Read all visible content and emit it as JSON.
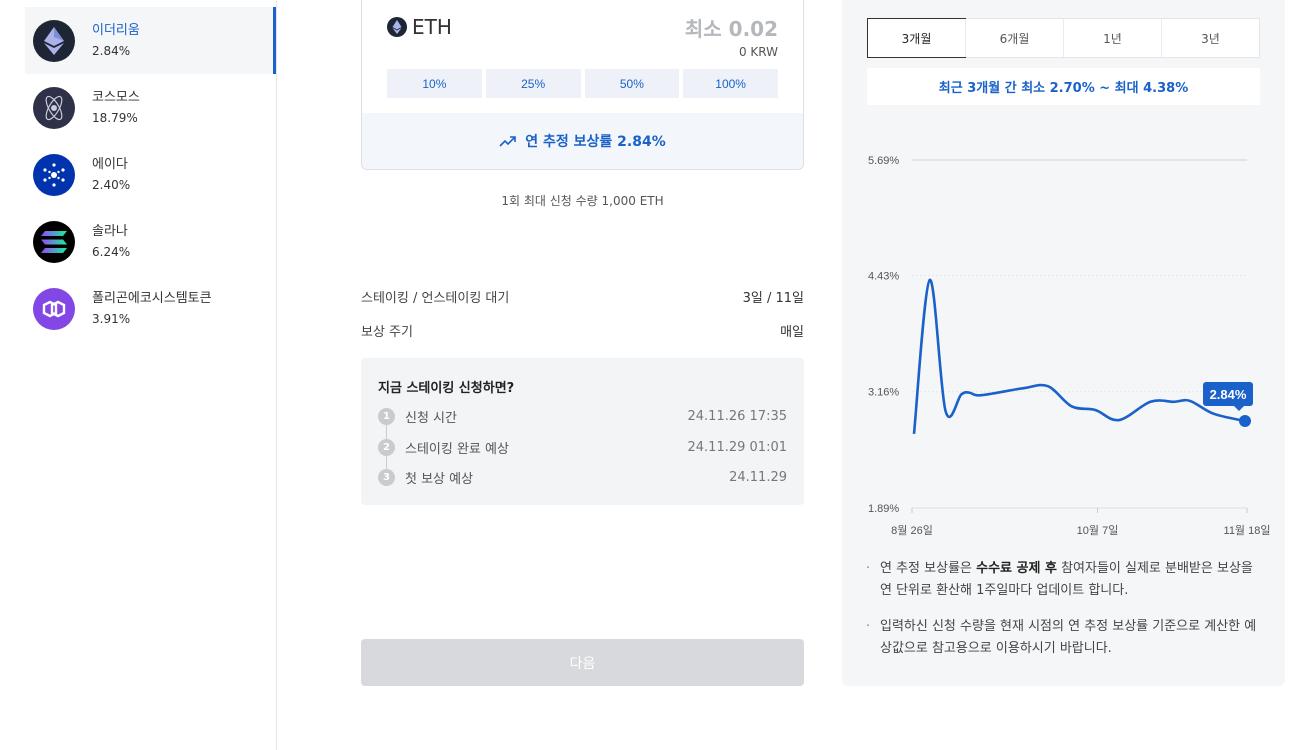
{
  "sidebar": {
    "items": [
      {
        "name": "이더리움",
        "rate": "2.84%",
        "icon": "ethereum-icon",
        "color": "#1e2535"
      },
      {
        "name": "코스모스",
        "rate": "18.79%",
        "icon": "cosmos-icon",
        "color": "#2e3148"
      },
      {
        "name": "에이다",
        "rate": "2.40%",
        "icon": "cardano-icon",
        "color": "#0033ad"
      },
      {
        "name": "솔라나",
        "rate": "6.24%",
        "icon": "solana-icon",
        "color": "#000000"
      },
      {
        "name": "폴리곤에코시스템토큰",
        "rate": "3.91%",
        "icon": "polygon-icon",
        "color": "#8247e5"
      }
    ]
  },
  "stake_card": {
    "ticker": "ETH",
    "min_amount": "최소 0.02",
    "krw_value": "0 KRW",
    "percent_buttons": [
      "10%",
      "25%",
      "50%",
      "100%"
    ],
    "annual_reward": "연 추정 보상률 2.84%"
  },
  "max_note": "1회 최대 신청 수량 1,000 ETH",
  "info": {
    "wait_label": "스테이킹 / 언스테이킹 대기",
    "wait_value": "3일 / 11일",
    "cycle_label": "보상 주기",
    "cycle_value": "매일"
  },
  "schedule": {
    "title": "지금 스테이킹 신청하면?",
    "steps": [
      {
        "num": "1",
        "label": "신청 시간",
        "date": "24.11.26 17:35"
      },
      {
        "num": "2",
        "label": "스테이킹 완료 예상",
        "date": "24.11.29 01:01"
      },
      {
        "num": "3",
        "label": "첫 보상 예상",
        "date": "24.11.29"
      }
    ]
  },
  "next_button": "다음",
  "periods": {
    "tabs": [
      "3개월",
      "6개월",
      "1년",
      "3년"
    ],
    "active": "3개월",
    "range_text": "최근 3개월 간 최소 2.70% ~ 최대 4.38%"
  },
  "chart_data": {
    "type": "line",
    "y_ticks": [
      "5.69%",
      "4.43%",
      "3.16%",
      "1.89%"
    ],
    "x_ticks": [
      "8월 26일",
      "10월 7일",
      "11월 18일"
    ],
    "ylim": [
      1.89,
      5.69
    ],
    "series": [
      {
        "x": [
          0,
          4,
          8,
          12,
          14,
          16,
          20,
          28,
          34,
          40,
          46,
          52,
          60,
          66,
          70,
          76,
          84
        ],
        "values": [
          2.7,
          4.38,
          2.95,
          3.13,
          3.15,
          3.12,
          3.14,
          3.2,
          3.22,
          3.0,
          2.96,
          2.85,
          3.05,
          3.05,
          3.06,
          2.92,
          2.84
        ]
      }
    ],
    "current_label": "2.84%",
    "color": "#1a61c9"
  },
  "notes": [
    {
      "pre": "연 추정 보상률은 ",
      "bold": "수수료 공제 후",
      "post": " 참여자들이 실제로 분배받은 보상을 연 단위로 환산해 1주일마다 업데이트 합니다."
    },
    {
      "pre": "입력하신 신청 수량을 현재 시점의 연 추정 보상률 기준으로 계산한 예상값으로 참고용으로 이용하시기 바랍니다.",
      "bold": "",
      "post": ""
    }
  ]
}
